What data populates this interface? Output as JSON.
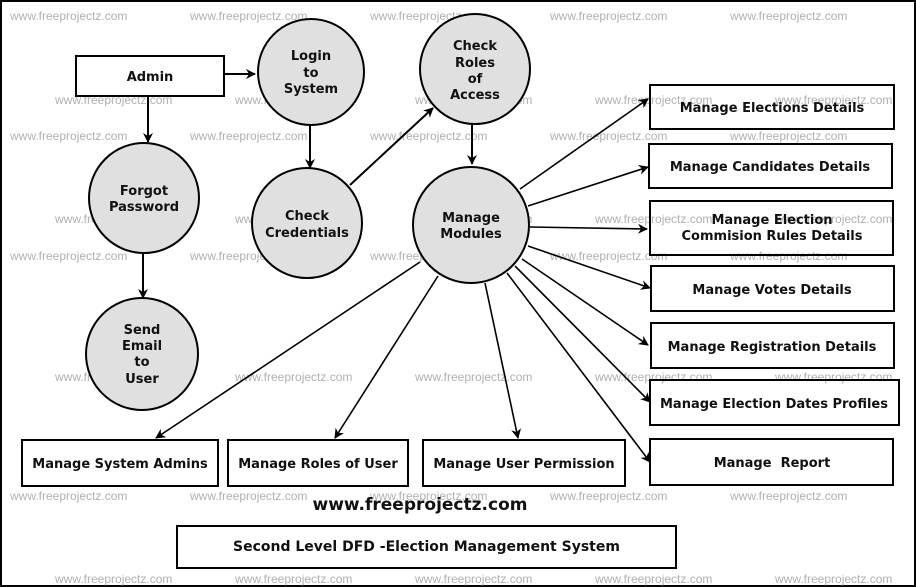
{
  "watermark": "www.freeprojectz.com",
  "site_title": "www.freeprojectz.com",
  "caption": "Second Level DFD -Election Management System",
  "colors": {
    "process_fill": "#e0e0e0",
    "stroke": "#000000",
    "watermark": "#b0b0b0"
  },
  "entities": {
    "admin": "Admin"
  },
  "processes": {
    "login": [
      "Login",
      "to",
      "System"
    ],
    "check_roles": [
      "Check",
      "Roles",
      "of",
      "Access"
    ],
    "forgot_password": [
      "Forgot",
      "Password"
    ],
    "check_credentials": [
      "Check",
      "Credentials"
    ],
    "manage_modules": [
      "Manage",
      "Modules"
    ],
    "send_email": [
      "Send",
      "Email",
      "to",
      "User"
    ]
  },
  "data_stores": {
    "elections": "Manage Elections Details",
    "candidates": "Manage Candidates Details",
    "commission_rules": [
      "Manage Election",
      "Commision Rules Details"
    ],
    "votes": "Manage Votes Details",
    "registration": "Manage Registration Details",
    "election_dates": "Manage Election Dates Profiles",
    "report": "Manage  Report",
    "system_admins": "Manage System Admins",
    "roles_of_user": "Manage Roles of User",
    "user_permission": "Manage User Permission"
  }
}
